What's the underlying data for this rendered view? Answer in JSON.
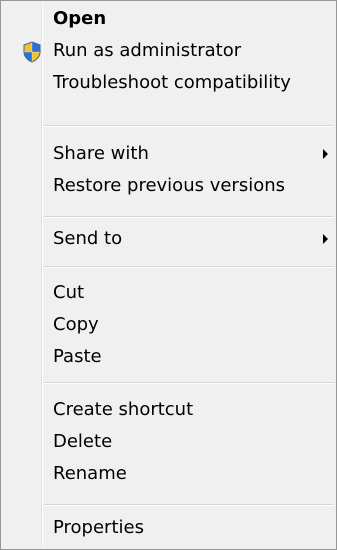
{
  "menu": {
    "items": [
      {
        "label": "Open"
      },
      {
        "label": "Run as administrator",
        "icon": "uac-shield-icon"
      },
      {
        "label": "Troubleshoot compatibility"
      },
      {
        "label": "Share with",
        "submenu": true
      },
      {
        "label": "Restore previous versions"
      },
      {
        "label": "Send to",
        "submenu": true
      },
      {
        "label": "Cut"
      },
      {
        "label": "Copy"
      },
      {
        "label": "Paste"
      },
      {
        "label": "Create shortcut"
      },
      {
        "label": "Delete"
      },
      {
        "label": "Rename"
      },
      {
        "label": "Properties"
      }
    ],
    "colors": {
      "background": "#f0f0f0",
      "border": "#979797",
      "separator": "#d7d7d7"
    }
  }
}
